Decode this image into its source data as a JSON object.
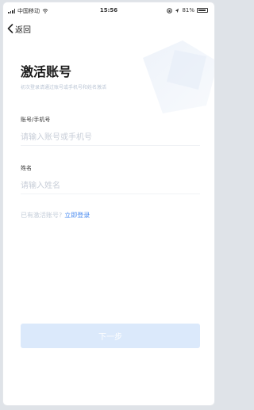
{
  "status_bar": {
    "carrier": "中国移动",
    "time": "15:56",
    "battery": "81%"
  },
  "nav": {
    "back_label": "返回"
  },
  "page": {
    "title": "激活账号",
    "subtitle": "初次登录请通过账号或手机号和姓名激活"
  },
  "form": {
    "account_label": "账号/手机号",
    "account_placeholder": "请输入账号或手机号",
    "account_value": "",
    "name_label": "姓名",
    "name_placeholder": "请输入姓名",
    "name_value": ""
  },
  "activated": {
    "prompt": "已有激活账号?",
    "link": "立即登录"
  },
  "actions": {
    "next_label": "下一步"
  },
  "colors": {
    "accent": "#4a8bf0",
    "button_disabled": "#dbe9fb"
  }
}
